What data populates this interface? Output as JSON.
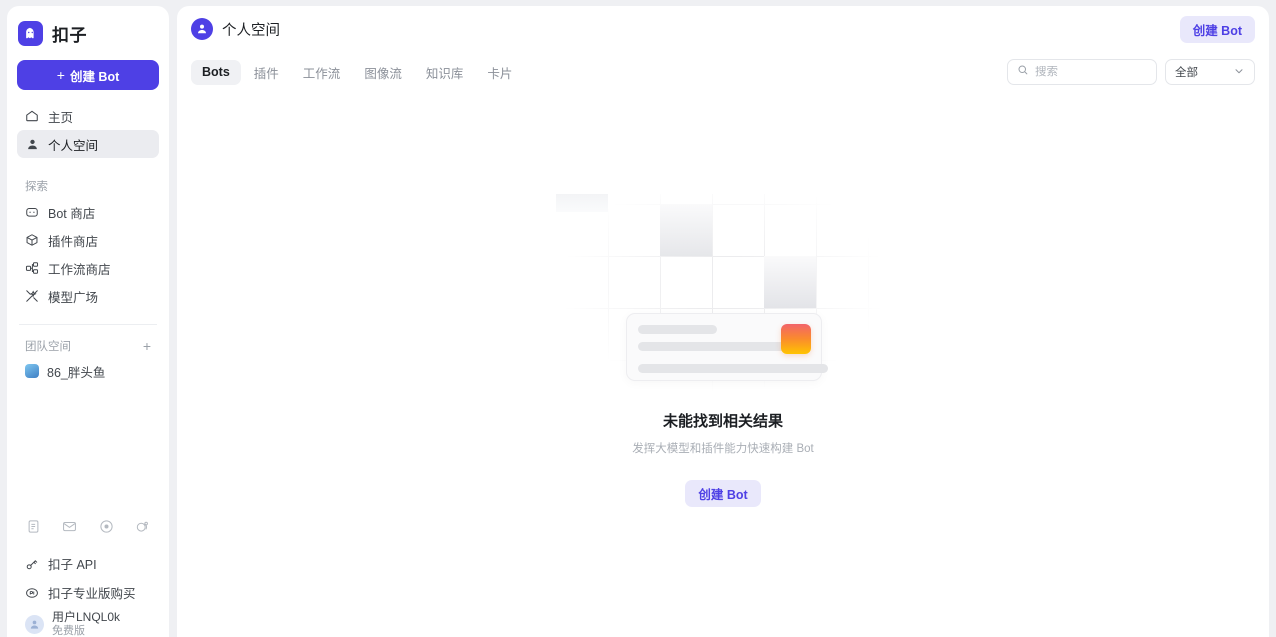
{
  "brand": {
    "name": "扣子",
    "logo_icon": "bot-ghost-icon"
  },
  "sidebar": {
    "create_button": {
      "label": "创建 Bot",
      "plus": "+"
    },
    "nav": [
      {
        "label": "主页",
        "icon": "home-icon",
        "active": false
      },
      {
        "label": "个人空间",
        "icon": "person-icon",
        "active": true
      }
    ],
    "explore_label": "探索",
    "explore": [
      {
        "label": "Bot 商店",
        "icon": "bot-store-icon"
      },
      {
        "label": "插件商店",
        "icon": "plugin-cube-icon"
      },
      {
        "label": "工作流商店",
        "icon": "workflow-icon"
      },
      {
        "label": "模型广场",
        "icon": "model-sparkle-icon"
      }
    ],
    "team_label": "团队空间",
    "team_add": "+",
    "teams": [
      {
        "label": "86_胖头鱼",
        "avatar": "team-avatar"
      }
    ],
    "quick_icons": [
      {
        "name": "document-icon"
      },
      {
        "name": "mail-icon"
      },
      {
        "name": "target-icon"
      },
      {
        "name": "discord-icon"
      }
    ],
    "footer_links": [
      {
        "label": "扣子 API",
        "icon": "api-key-icon"
      },
      {
        "label": "扣子专业版购买",
        "icon": "coin-icon"
      }
    ],
    "user": {
      "name": "用户LNQL0k",
      "sub": "免费版",
      "avatar": "user-avatar"
    }
  },
  "header": {
    "workspace_icon": "person-icon",
    "title": "个人空间",
    "create_button": "创建 Bot"
  },
  "toolbar": {
    "tabs": [
      {
        "label": "Bots",
        "active": true
      },
      {
        "label": "插件",
        "active": false
      },
      {
        "label": "工作流",
        "active": false
      },
      {
        "label": "图像流",
        "active": false
      },
      {
        "label": "知识库",
        "active": false
      },
      {
        "label": "卡片",
        "active": false
      }
    ],
    "search": {
      "placeholder": "搜索",
      "value": "",
      "icon": "search-icon"
    },
    "filter": {
      "value": "全部",
      "icon": "chevron-down-icon"
    }
  },
  "empty_state": {
    "title": "未能找到相关结果",
    "subtitle": "发挥大模型和插件能力快速构建 Bot",
    "cta": "创建 Bot"
  },
  "colors": {
    "brand_purple": "#4E40E5",
    "ghost_button_bg": "#E9E8FB",
    "page_bg": "#EFF0F3",
    "panel_bg": "#FFFFFF",
    "thumb_gradient_top": "#F2646A",
    "thumb_gradient_bottom": "#FFC400"
  }
}
